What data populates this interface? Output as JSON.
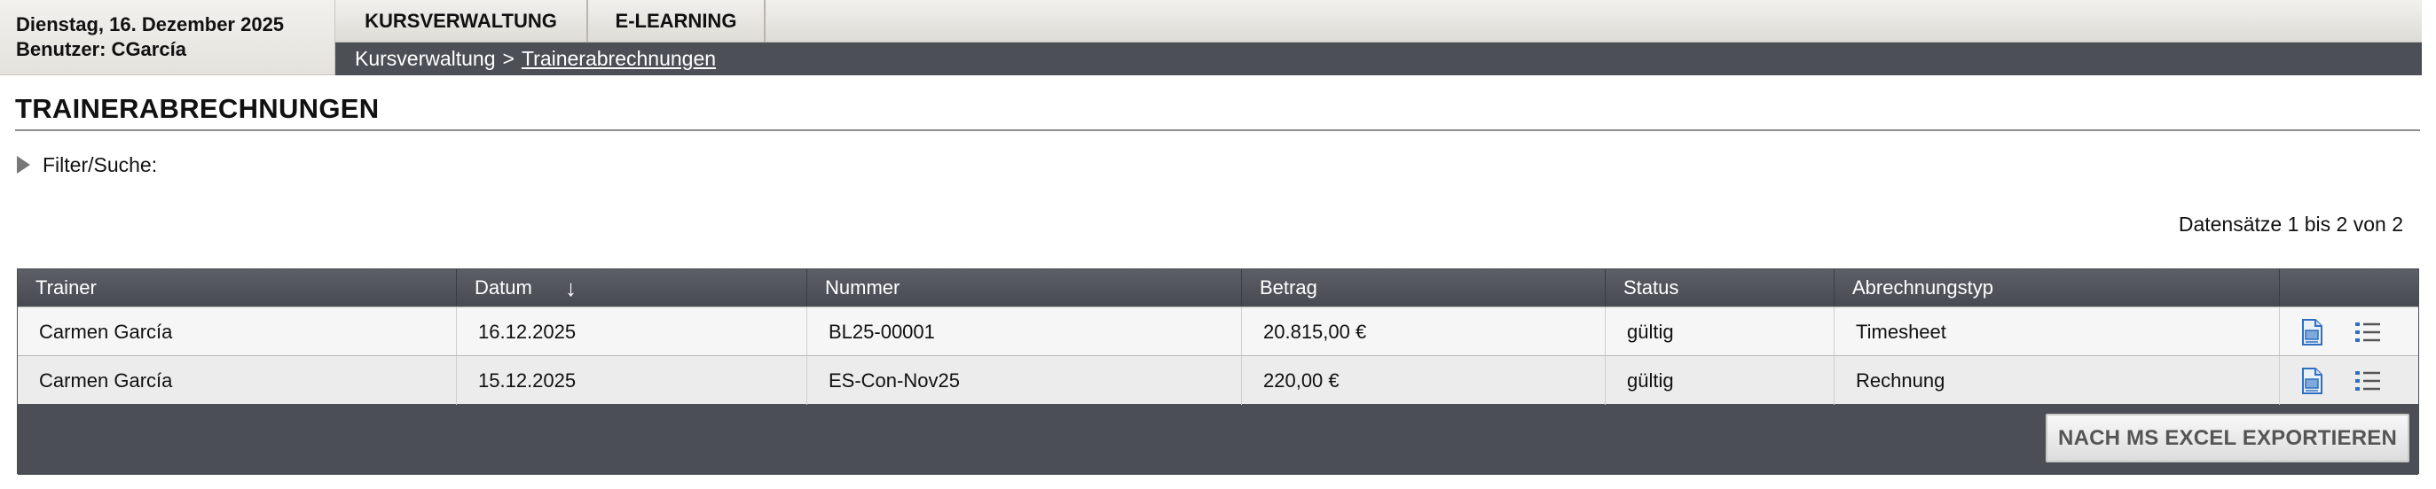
{
  "user": {
    "date": "Dienstag, 16. Dezember 2025",
    "user_line": "Benutzer: CGarcía"
  },
  "nav": {
    "tabs": [
      {
        "label": "KURSVERWALTUNG"
      },
      {
        "label": "E-LEARNING"
      }
    ],
    "breadcrumb": {
      "parent": "Kursverwaltung",
      "separator": ">",
      "current": "Trainerabrechnungen"
    }
  },
  "page": {
    "title": "TRAINERABRECHNUNGEN",
    "filter_label": "Filter/Suche:",
    "records_info": "Datensätze 1 bis 2 von 2"
  },
  "table": {
    "columns": [
      "Trainer",
      "Datum",
      "Nummer",
      "Betrag",
      "Status",
      "Abrechnungstyp"
    ],
    "sort_indicator": "↓",
    "rows": [
      {
        "trainer": "Carmen García",
        "datum": "16.12.2025",
        "nummer": "BL25-00001",
        "betrag": "20.815,00 €",
        "status": "gültig",
        "typ": "Timesheet"
      },
      {
        "trainer": "Carmen García",
        "datum": "15.12.2025",
        "nummer": "ES-Con-Nov25",
        "betrag": "220,00 €",
        "status": "gültig",
        "typ": "Rechnung"
      }
    ],
    "row_icons": [
      "document-edit-icon",
      "list-details-icon"
    ],
    "export_label": "NACH MS EXCEL EXPORTIEREN"
  },
  "colors": {
    "header_dark": "#4c5056",
    "table_header": "#4b4f55",
    "icon_blue": "#2f6fc0"
  }
}
